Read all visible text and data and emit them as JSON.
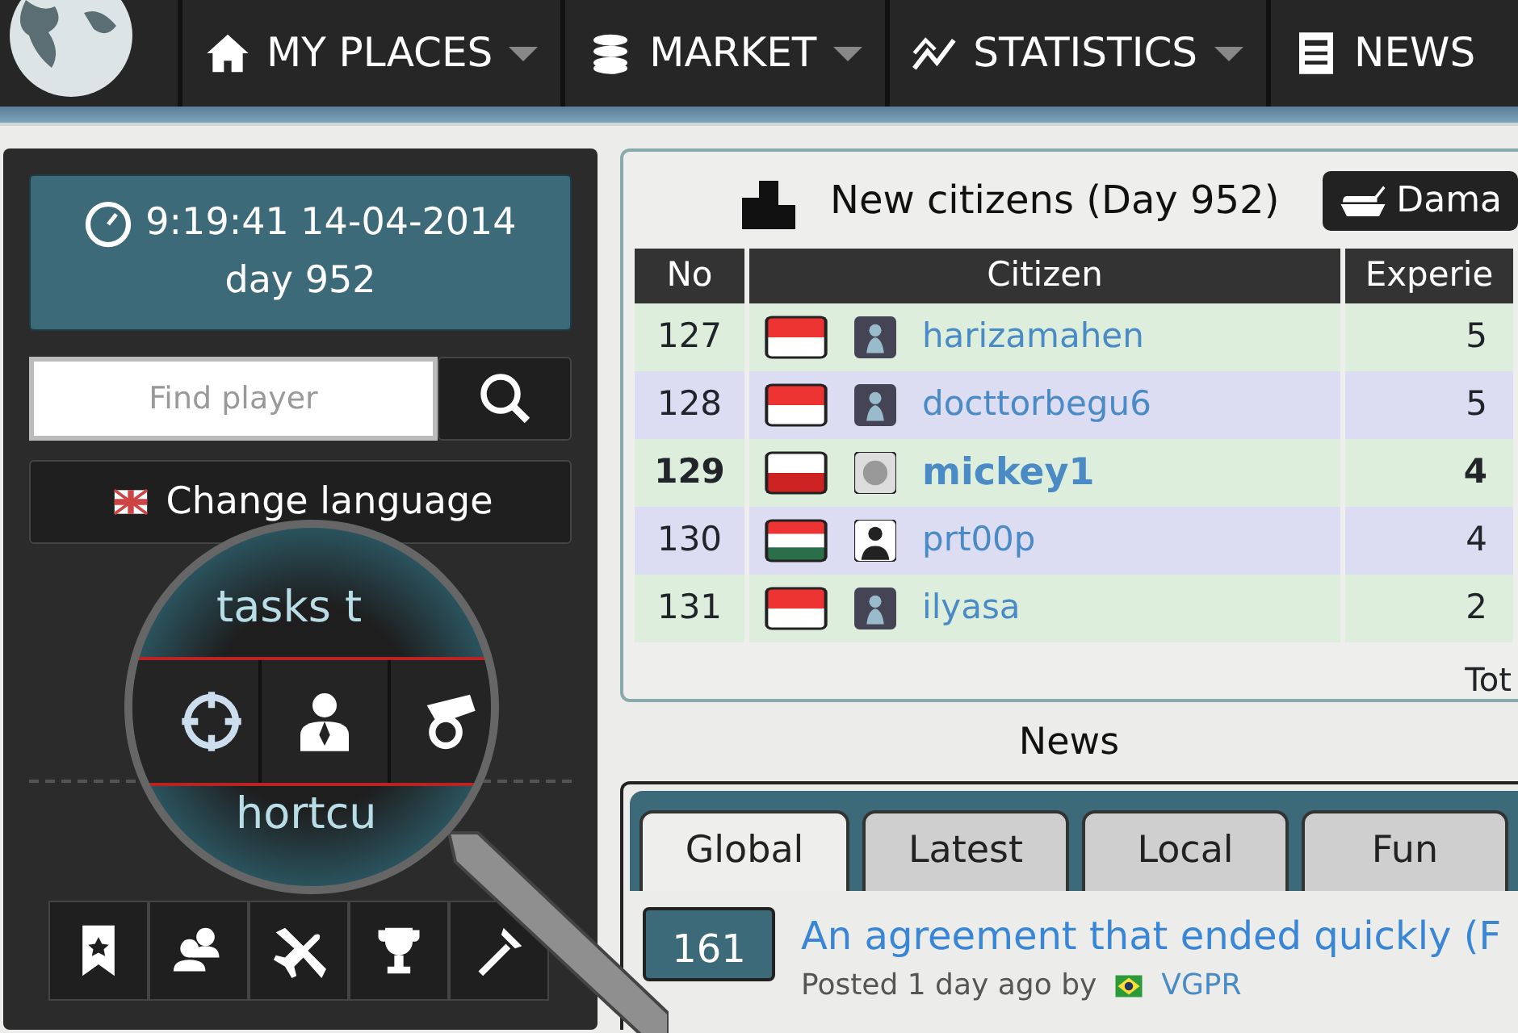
{
  "nav": {
    "items": [
      {
        "label": "MY PLACES",
        "kind": "home",
        "dropdown": true
      },
      {
        "label": "MARKET",
        "kind": "coins",
        "dropdown": true
      },
      {
        "label": "STATISTICS",
        "kind": "chart",
        "dropdown": true
      },
      {
        "label": "NEWS",
        "kind": "paper",
        "dropdown": false
      }
    ]
  },
  "sidebar": {
    "clock": {
      "time": "9:19:41 14-04-2014",
      "day": "day 952"
    },
    "search": {
      "placeholder": "Find player"
    },
    "language_button": {
      "label": "Change language"
    },
    "magnifier": {
      "text_top": "tasks t",
      "text_bottom": "hortcu"
    },
    "shortcuts": [
      {
        "kind": "bookmark"
      },
      {
        "kind": "people"
      },
      {
        "kind": "plane"
      },
      {
        "kind": "trophy"
      },
      {
        "kind": "tools"
      }
    ]
  },
  "citizens": {
    "title": "New citizens (Day 952)",
    "button_label": "Dama",
    "columns": [
      "No",
      "Citizen",
      "Experie"
    ],
    "rows": [
      {
        "no": "127",
        "name": "harizamahen",
        "experience": "5",
        "flag": {
          "kind": "redwhite"
        },
        "avatar": {
          "kind": "pawn"
        },
        "bold": false
      },
      {
        "no": "128",
        "name": "docttorbegu6",
        "experience": "5",
        "flag": {
          "kind": "redwhite"
        },
        "avatar": {
          "kind": "pawn"
        },
        "bold": false
      },
      {
        "no": "129",
        "name": "mickey1",
        "experience": "4",
        "flag": {
          "kind": "whitered"
        },
        "avatar": {
          "kind": "face"
        },
        "bold": true
      },
      {
        "no": "130",
        "name": "prt00p",
        "experience": "4",
        "flag": {
          "kind": "tricolor"
        },
        "avatar": {
          "kind": "suit"
        },
        "bold": false
      },
      {
        "no": "131",
        "name": "ilyasa",
        "experience": "2",
        "flag": {
          "kind": "redwhite"
        },
        "avatar": {
          "kind": "pawn"
        },
        "bold": false
      }
    ],
    "footer": "Tot"
  },
  "news": {
    "heading": "News",
    "tabs": [
      {
        "label": "Global",
        "selected": true
      },
      {
        "label": "Latest",
        "selected": false
      },
      {
        "label": "Local",
        "selected": false
      },
      {
        "label": "Fun",
        "selected": false
      }
    ],
    "article": {
      "count": "161",
      "title": "An agreement that ended quickly (F",
      "meta": "Posted 1 day ago by",
      "author": "VGPR"
    }
  }
}
